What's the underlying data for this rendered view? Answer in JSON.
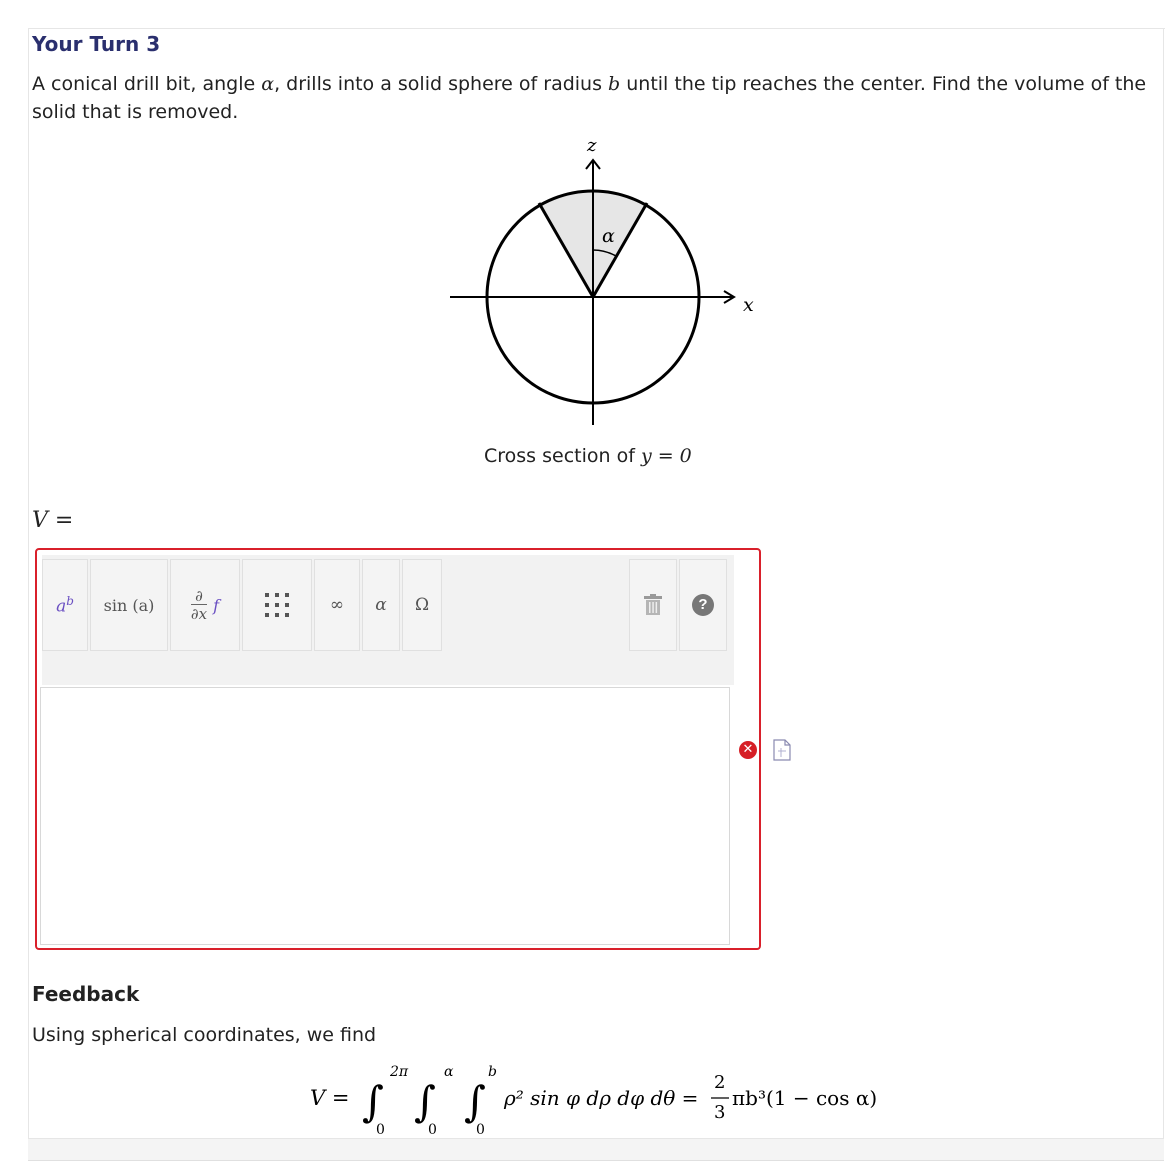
{
  "question": {
    "title": "Your Turn 3",
    "text_before_alpha": "A conical drill bit, angle ",
    "alpha_symbol": "α",
    "text_between": ", drills into a solid sphere of radius ",
    "radius_symbol": "b",
    "text_after": " until the tip reaches the center. Find the volume of the solid that is removed."
  },
  "figure": {
    "z_label": "z",
    "x_label": "x",
    "alpha_label": "α",
    "caption_text": "Cross section of ",
    "caption_math": "y = 0"
  },
  "answer": {
    "variable": "V =",
    "editor_value": "",
    "toolbar": {
      "power": "a",
      "power_sup": "b",
      "sin": "sin (a)",
      "deriv_top": "∂",
      "deriv_bottom": "∂x",
      "deriv_f": "f",
      "infinity": "∞",
      "alpha": "α",
      "omega": "Ω"
    },
    "status": "error",
    "status_color": "#d61f26",
    "accent_border": "#d9202b"
  },
  "feedback": {
    "title": "Feedback",
    "text": "Using spherical coordinates, we find",
    "formula": {
      "lhs": "V =",
      "upper1": "2π",
      "upper2": "α",
      "upper3": "b",
      "lower": "0",
      "integrand": "ρ² sin φ dρ dφ dθ =",
      "frac_num": "2",
      "frac_den": "3",
      "result": "πb³(1 − cos α)"
    }
  }
}
